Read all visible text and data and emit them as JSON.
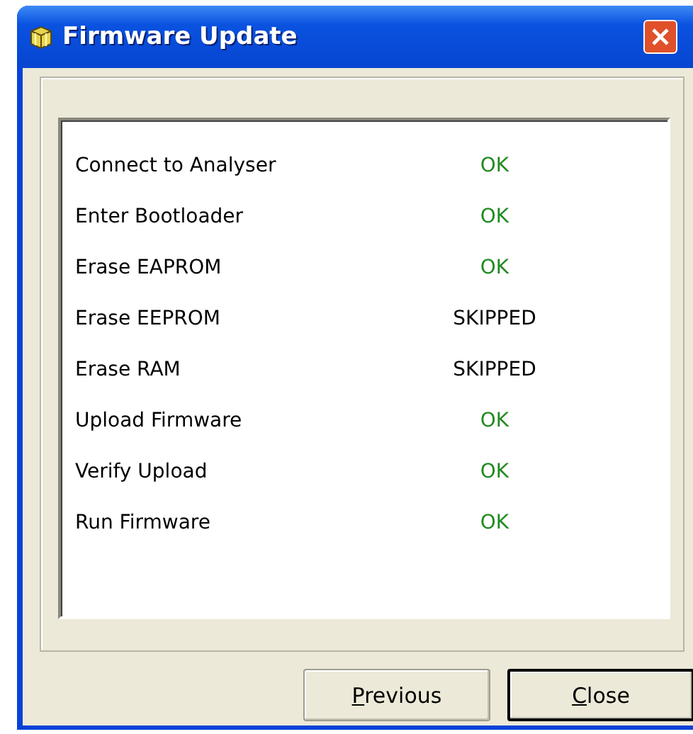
{
  "window": {
    "title": "Firmware Update"
  },
  "steps": [
    {
      "name": "Connect to Analyser",
      "status": "OK",
      "kind": "ok"
    },
    {
      "name": "Enter Bootloader",
      "status": "OK",
      "kind": "ok"
    },
    {
      "name": "Erase EAPROM",
      "status": "OK",
      "kind": "ok"
    },
    {
      "name": "Erase EEPROM",
      "status": "SKIPPED",
      "kind": "skipped"
    },
    {
      "name": "Erase RAM",
      "status": "SKIPPED",
      "kind": "skipped"
    },
    {
      "name": "Upload Firmware",
      "status": "OK",
      "kind": "ok"
    },
    {
      "name": "Verify Upload",
      "status": "OK",
      "kind": "ok"
    },
    {
      "name": "Run Firmware",
      "status": "OK",
      "kind": "ok"
    }
  ],
  "buttons": [
    {
      "label": "Previous",
      "default": false
    },
    {
      "label": "Close",
      "default": true
    }
  ]
}
